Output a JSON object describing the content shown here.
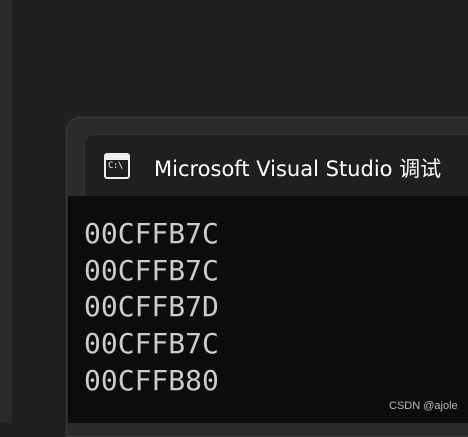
{
  "window": {
    "title": "Microsoft Visual Studio 调试",
    "icon": "console-icon",
    "icon_glyph": "C:\\"
  },
  "console": {
    "lines": [
      "00CFFB7C",
      "00CFFB7C",
      "00CFFB7D",
      "00CFFB7C",
      "00CFFB80"
    ]
  },
  "watermark": "CSDN @ajole",
  "colors": {
    "background": "#202020",
    "console_bg": "#0c0c0c",
    "console_text": "#cccccc",
    "title_text": "#ffffff"
  }
}
